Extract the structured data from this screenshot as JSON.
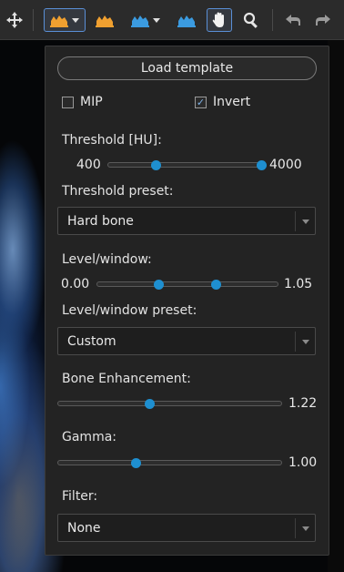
{
  "toolbar": {
    "icons": [
      "move-icon",
      "histogram-orange-icon",
      "histogram-orange-icon",
      "histogram-blue-icon",
      "histogram-blue-icon",
      "hand-pan-icon",
      "zoom-icon",
      "undo-icon",
      "redo-icon"
    ],
    "accent": "#5a8fd6",
    "orange": "#f0a030",
    "blue": "#3b9be0"
  },
  "panel": {
    "load_template_label": "Load template",
    "mip": {
      "label": "MIP",
      "checked": false
    },
    "invert": {
      "label": "Invert",
      "checked": true
    },
    "threshold": {
      "label": "Threshold [HU]:",
      "min_label": "400",
      "max_label": "4000",
      "low_fraction": 0.31,
      "high_fraction": 1.0
    },
    "threshold_preset": {
      "label": "Threshold preset:",
      "value": "Hard bone"
    },
    "level_window": {
      "label": "Level/window:",
      "min_label": "0.00",
      "max_label": "1.05",
      "low_fraction": 0.34,
      "high_fraction": 0.66
    },
    "level_window_preset": {
      "label": "Level/window preset:",
      "value": "Custom"
    },
    "bone_enhancement": {
      "label": "Bone Enhancement:",
      "value": "1.22",
      "fraction": 0.41
    },
    "gamma": {
      "label": "Gamma:",
      "value": "1.00",
      "fraction": 0.35
    },
    "filter": {
      "label": "Filter:",
      "value": "None"
    }
  }
}
